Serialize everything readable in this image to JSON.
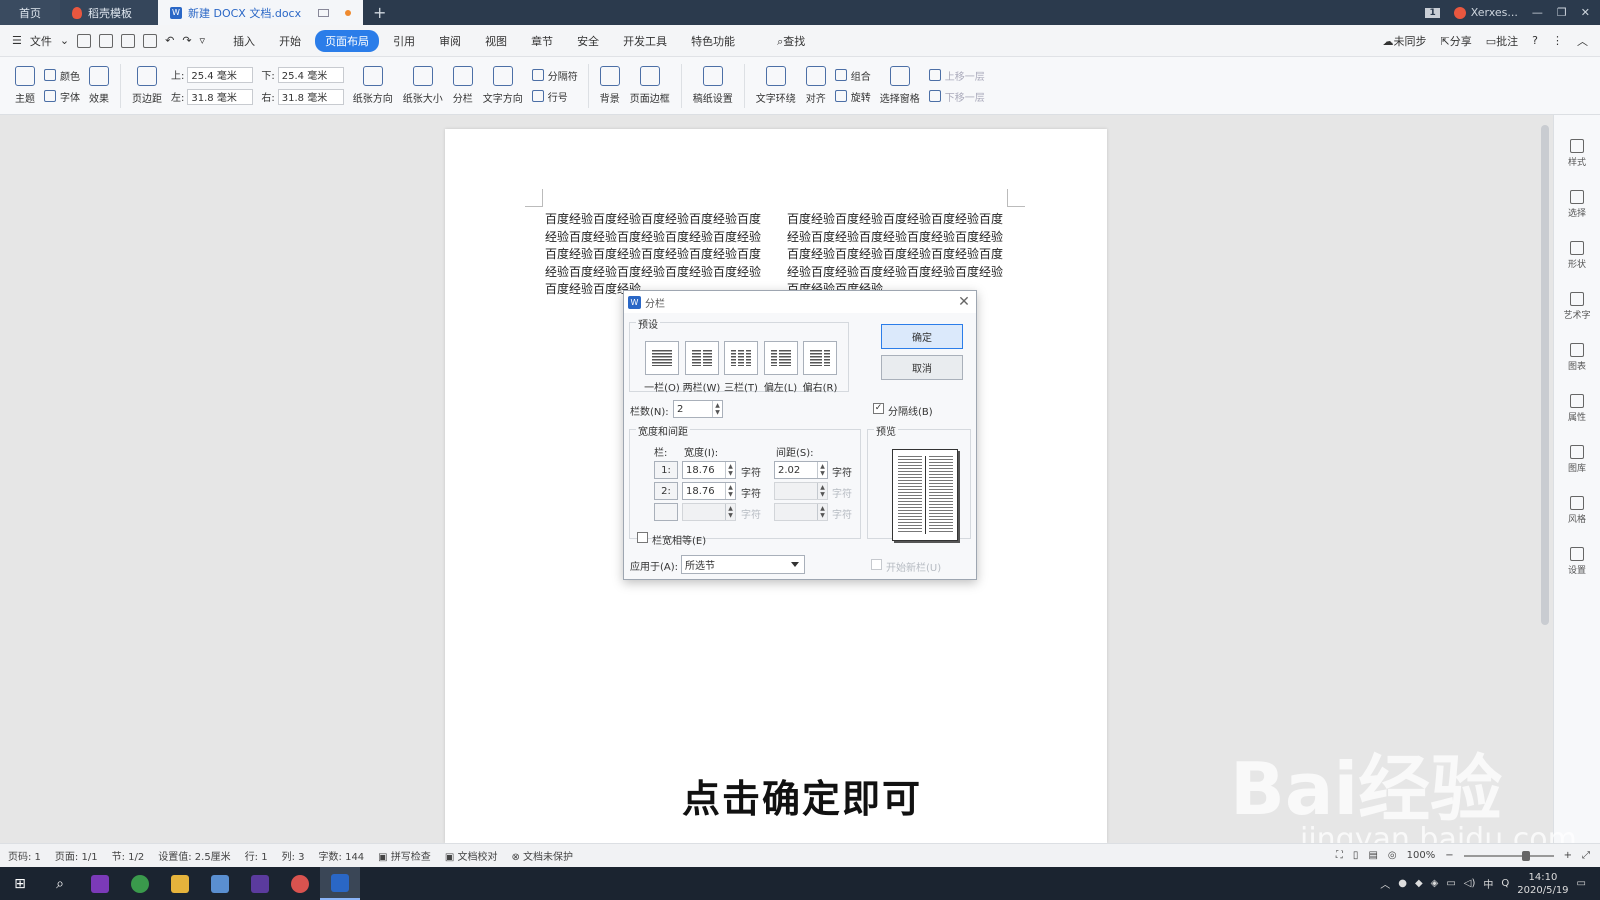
{
  "tabs": {
    "home": "首页",
    "template": "稻壳模板",
    "document": "新建 DOCX 文档.docx",
    "badge": "1",
    "user": "Xerxes..."
  },
  "menu": {
    "file": "文件",
    "items": [
      "插入",
      "开始",
      "页面布局",
      "引用",
      "审阅",
      "视图",
      "章节",
      "安全",
      "开发工具",
      "特色功能"
    ],
    "active_index": 2,
    "search": "查找",
    "sync": "未同步",
    "share": "分享",
    "comment": "批注"
  },
  "ribbon": {
    "theme": "主题",
    "color": "颜色",
    "font": "字体",
    "effect": "效果",
    "margins": "页边距",
    "top_label": "上:",
    "top_value": "25.4 毫米",
    "bottom_label": "下:",
    "bottom_value": "25.4 毫米",
    "left_label": "左:",
    "left_value": "31.8 毫米",
    "right_label": "右:",
    "right_value": "31.8 毫米",
    "orientation": "纸张方向",
    "size": "纸张大小",
    "columns": "分栏",
    "text_direction": "文字方向",
    "separator": "分隔符",
    "line_no": "行号",
    "background": "背景",
    "page_border": "页面边框",
    "paper_setup": "稿纸设置",
    "wrap": "文字环绕",
    "align": "对齐",
    "group": "组合",
    "rotate": "旋转",
    "select_pane": "选择窗格",
    "bring_forward": "上移一层",
    "send_backward": "下移一层"
  },
  "document": {
    "col1": "百度经验百度经验百度经验百度经验百度经验百度经验百度经验百度经验百度经验百度经验百度经验百度经验百度经验百度经验百度经验百度经验百度经验百度经验百度经验百度经验",
    "col2": "百度经验百度经验百度经验百度经验百度经验百度经验百度经验百度经验百度经验百度经验百度经验百度经验百度经验百度经验百度经验百度经验百度经验百度经验百度经验百度经验"
  },
  "subtitle": "点击确定即可",
  "watermark": "Bai经验",
  "watermark_url": "jingyan.baidu.com",
  "sidebar": [
    "样式",
    "选择",
    "形状",
    "艺术字",
    "图表",
    "属性",
    "图库",
    "风格",
    "设置"
  ],
  "dialog": {
    "title": "分栏",
    "preset_label": "预设",
    "presets": [
      "一栏(O)",
      "两栏(W)",
      "三栏(T)",
      "偏左(L)",
      "偏右(R)"
    ],
    "ok": "确定",
    "cancel": "取消",
    "count_label": "栏数(N):",
    "count_value": "2",
    "separator_label": "分隔线(B)",
    "separator_checked": true,
    "width_spacing_label": "宽度和间距",
    "preview_label": "预览",
    "col_header": "栏:",
    "width_header": "宽度(I):",
    "spacing_header": "间距(S):",
    "rows": [
      {
        "idx": "1:",
        "width": "18.76",
        "spacing": "2.02"
      },
      {
        "idx": "2:",
        "width": "18.76",
        "spacing": ""
      },
      {
        "idx": "",
        "width": "",
        "spacing": ""
      }
    ],
    "unit": "字符",
    "equal_width_label": "栏宽相等(E)",
    "apply_label": "应用于(A):",
    "apply_value": "所选节",
    "new_column_label": "开始新栏(U)"
  },
  "status": {
    "page_no": "页码: 1",
    "pages": "页面: 1/1",
    "section": "节: 1/2",
    "setting": "设置值: 2.5厘米",
    "row": "行: 1",
    "col": "列: 3",
    "words": "字数: 144",
    "spell": "拼写检查",
    "proof": "文档校对",
    "protect": "文档未保护",
    "zoom": "100%"
  },
  "taskbar": {
    "time": "14:10",
    "date": "2020/5/19",
    "ime": "中"
  }
}
